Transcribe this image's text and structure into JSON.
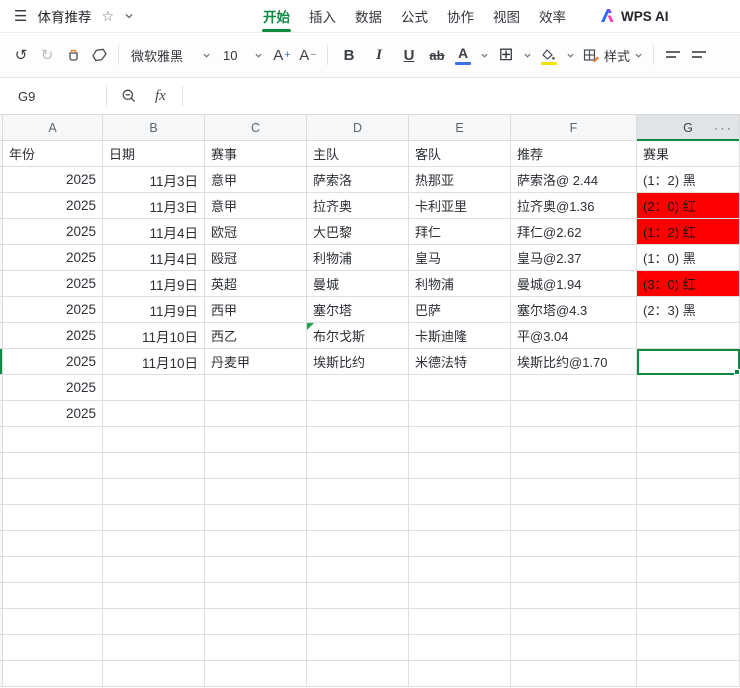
{
  "titlebar": {
    "doc_title": "体育推荐",
    "tabs": [
      "开始",
      "插入",
      "数据",
      "公式",
      "协作",
      "视图",
      "效率"
    ],
    "active_tab": "开始",
    "wps_ai_label": "WPS AI"
  },
  "toolbar": {
    "font_name": "微软雅黑",
    "font_size": "10",
    "bold": "B",
    "italic": "I",
    "underline": "U",
    "strikethrough": "ab",
    "font_color_letter": "A",
    "increase_font_letter": "A",
    "increase_font_sign": "+",
    "decrease_font_letter": "A",
    "decrease_font_sign": "−",
    "styles_label": "样式"
  },
  "formula_bar": {
    "cell_ref": "G9",
    "fx_label": "fx",
    "formula_value": ""
  },
  "icons": {
    "hamburger": "☰",
    "star": "☆",
    "undo": "↺",
    "redo": "↻",
    "border_grid": "⊞",
    "more_columns": "···"
  },
  "colors": {
    "accent_green": "#0e8a43",
    "result_red_bg": "#ff0000",
    "font_color_bar": "#3d6fe0",
    "fill_color_bar": "#f2e203",
    "flag_green": "#21a14b"
  },
  "sheet": {
    "columns": [
      "A",
      "B",
      "C",
      "D",
      "E",
      "F",
      "G"
    ],
    "active_column": "G",
    "selected_cell": "G9",
    "rows": [
      {
        "cells": [
          "年份",
          "日期",
          "赛事",
          "主队",
          "客队",
          "推荐",
          "赛果"
        ]
      },
      {
        "cells": [
          "2025",
          "11月3日",
          "意甲",
          "萨索洛",
          "热那亚",
          "萨索洛@ 2.44",
          "(1：2) 黑"
        ]
      },
      {
        "cells": [
          "2025",
          "11月3日",
          "意甲",
          "拉齐奥",
          "卡利亚里",
          "拉齐奥@1.36",
          "(2：0) 红"
        ],
        "g_red": true
      },
      {
        "cells": [
          "2025",
          "11月4日",
          "欧冠",
          "大巴黎",
          "拜仁",
          "拜仁@2.62",
          "(1：2) 红"
        ],
        "g_red": true
      },
      {
        "cells": [
          "2025",
          "11月4日",
          "殴冠",
          "利物浦",
          "皇马",
          "皇马@2.37",
          "(1：0) 黑"
        ]
      },
      {
        "cells": [
          "2025",
          "11月9日",
          "英超",
          "曼城",
          "利物浦",
          "曼城@1.94",
          "(3：0) 红"
        ],
        "g_red": true
      },
      {
        "cells": [
          "2025",
          "11月9日",
          "西甲",
          "塞尔塔",
          "巴萨",
          "塞尔塔@4.3",
          "(2：3) 黑"
        ]
      },
      {
        "cells": [
          "2025",
          "11月10日",
          "西乙",
          "布尔戈斯",
          "卡斯迪隆",
          "平@3.04",
          ""
        ],
        "corner_flag": true
      },
      {
        "cells": [
          "2025",
          "11月10日",
          "丹麦甲",
          "埃斯比约",
          "米德法特",
          "埃斯比约@1.70",
          ""
        ],
        "selected": true
      },
      {
        "cells": [
          "2025",
          "",
          "",
          "",
          "",
          "",
          ""
        ]
      },
      {
        "cells": [
          "2025",
          "",
          "",
          "",
          "",
          "",
          ""
        ]
      }
    ],
    "trailing_empty_rows": 10
  }
}
